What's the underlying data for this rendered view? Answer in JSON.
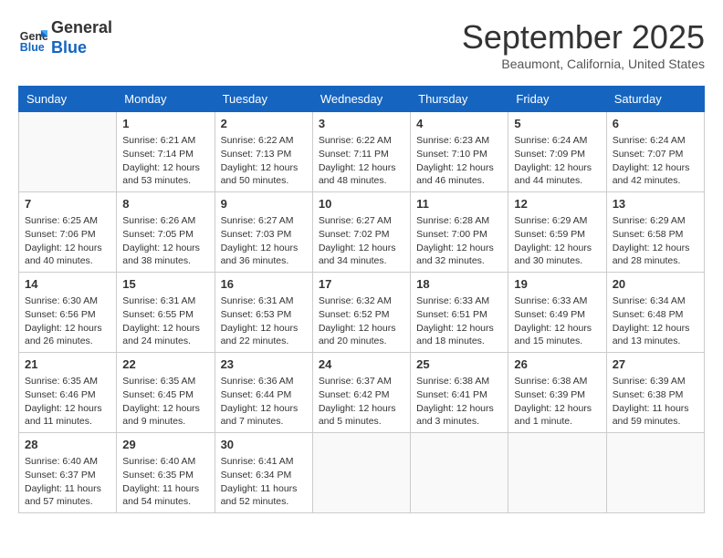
{
  "header": {
    "logo": {
      "line1": "General",
      "line2": "Blue"
    },
    "title": "September 2025",
    "location": "Beaumont, California, United States"
  },
  "weekdays": [
    "Sunday",
    "Monday",
    "Tuesday",
    "Wednesday",
    "Thursday",
    "Friday",
    "Saturday"
  ],
  "weeks": [
    [
      null,
      {
        "day": "1",
        "sunrise": "6:21 AM",
        "sunset": "7:14 PM",
        "daylight": "12 hours and 53 minutes."
      },
      {
        "day": "2",
        "sunrise": "6:22 AM",
        "sunset": "7:13 PM",
        "daylight": "12 hours and 50 minutes."
      },
      {
        "day": "3",
        "sunrise": "6:22 AM",
        "sunset": "7:11 PM",
        "daylight": "12 hours and 48 minutes."
      },
      {
        "day": "4",
        "sunrise": "6:23 AM",
        "sunset": "7:10 PM",
        "daylight": "12 hours and 46 minutes."
      },
      {
        "day": "5",
        "sunrise": "6:24 AM",
        "sunset": "7:09 PM",
        "daylight": "12 hours and 44 minutes."
      },
      {
        "day": "6",
        "sunrise": "6:24 AM",
        "sunset": "7:07 PM",
        "daylight": "12 hours and 42 minutes."
      }
    ],
    [
      {
        "day": "7",
        "sunrise": "6:25 AM",
        "sunset": "7:06 PM",
        "daylight": "12 hours and 40 minutes."
      },
      {
        "day": "8",
        "sunrise": "6:26 AM",
        "sunset": "7:05 PM",
        "daylight": "12 hours and 38 minutes."
      },
      {
        "day": "9",
        "sunrise": "6:27 AM",
        "sunset": "7:03 PM",
        "daylight": "12 hours and 36 minutes."
      },
      {
        "day": "10",
        "sunrise": "6:27 AM",
        "sunset": "7:02 PM",
        "daylight": "12 hours and 34 minutes."
      },
      {
        "day": "11",
        "sunrise": "6:28 AM",
        "sunset": "7:00 PM",
        "daylight": "12 hours and 32 minutes."
      },
      {
        "day": "12",
        "sunrise": "6:29 AM",
        "sunset": "6:59 PM",
        "daylight": "12 hours and 30 minutes."
      },
      {
        "day": "13",
        "sunrise": "6:29 AM",
        "sunset": "6:58 PM",
        "daylight": "12 hours and 28 minutes."
      }
    ],
    [
      {
        "day": "14",
        "sunrise": "6:30 AM",
        "sunset": "6:56 PM",
        "daylight": "12 hours and 26 minutes."
      },
      {
        "day": "15",
        "sunrise": "6:31 AM",
        "sunset": "6:55 PM",
        "daylight": "12 hours and 24 minutes."
      },
      {
        "day": "16",
        "sunrise": "6:31 AM",
        "sunset": "6:53 PM",
        "daylight": "12 hours and 22 minutes."
      },
      {
        "day": "17",
        "sunrise": "6:32 AM",
        "sunset": "6:52 PM",
        "daylight": "12 hours and 20 minutes."
      },
      {
        "day": "18",
        "sunrise": "6:33 AM",
        "sunset": "6:51 PM",
        "daylight": "12 hours and 18 minutes."
      },
      {
        "day": "19",
        "sunrise": "6:33 AM",
        "sunset": "6:49 PM",
        "daylight": "12 hours and 15 minutes."
      },
      {
        "day": "20",
        "sunrise": "6:34 AM",
        "sunset": "6:48 PM",
        "daylight": "12 hours and 13 minutes."
      }
    ],
    [
      {
        "day": "21",
        "sunrise": "6:35 AM",
        "sunset": "6:46 PM",
        "daylight": "12 hours and 11 minutes."
      },
      {
        "day": "22",
        "sunrise": "6:35 AM",
        "sunset": "6:45 PM",
        "daylight": "12 hours and 9 minutes."
      },
      {
        "day": "23",
        "sunrise": "6:36 AM",
        "sunset": "6:44 PM",
        "daylight": "12 hours and 7 minutes."
      },
      {
        "day": "24",
        "sunrise": "6:37 AM",
        "sunset": "6:42 PM",
        "daylight": "12 hours and 5 minutes."
      },
      {
        "day": "25",
        "sunrise": "6:38 AM",
        "sunset": "6:41 PM",
        "daylight": "12 hours and 3 minutes."
      },
      {
        "day": "26",
        "sunrise": "6:38 AM",
        "sunset": "6:39 PM",
        "daylight": "12 hours and 1 minute."
      },
      {
        "day": "27",
        "sunrise": "6:39 AM",
        "sunset": "6:38 PM",
        "daylight": "11 hours and 59 minutes."
      }
    ],
    [
      {
        "day": "28",
        "sunrise": "6:40 AM",
        "sunset": "6:37 PM",
        "daylight": "11 hours and 57 minutes."
      },
      {
        "day": "29",
        "sunrise": "6:40 AM",
        "sunset": "6:35 PM",
        "daylight": "11 hours and 54 minutes."
      },
      {
        "day": "30",
        "sunrise": "6:41 AM",
        "sunset": "6:34 PM",
        "daylight": "11 hours and 52 minutes."
      },
      null,
      null,
      null,
      null
    ]
  ]
}
